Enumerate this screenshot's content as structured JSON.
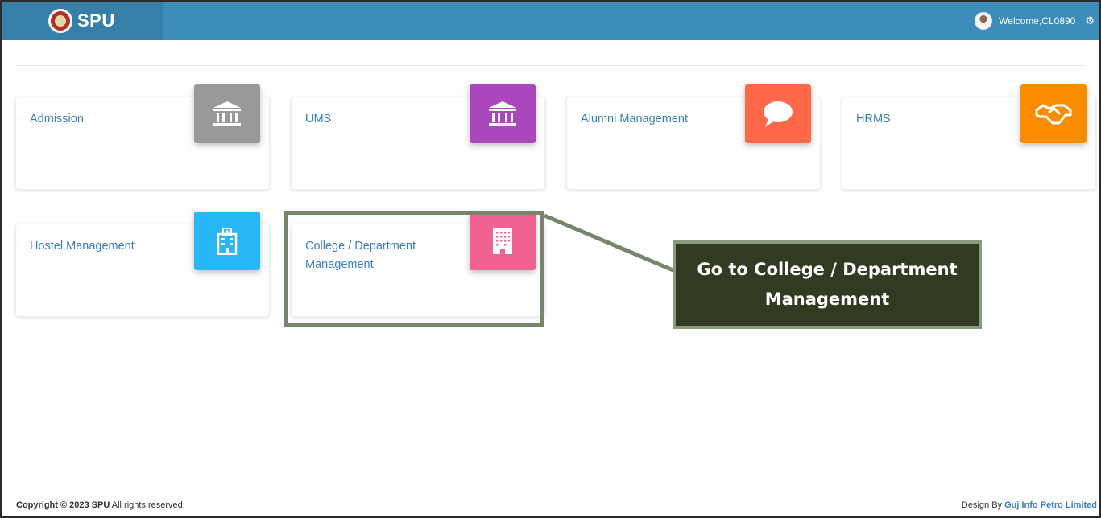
{
  "header": {
    "brand": "SPU",
    "welcome": "Welcome,CL0890"
  },
  "modules": [
    {
      "label": "Admission",
      "icon": "bank-icon",
      "color": "#999999"
    },
    {
      "label": "UMS",
      "icon": "bank-icon",
      "color": "#ab47bc"
    },
    {
      "label": "Alumni Management",
      "icon": "chat-bubble-icon",
      "color": "#ff6849"
    },
    {
      "label": "HRMS",
      "icon": "handshake-icon",
      "color": "#fb8c00"
    },
    {
      "label": "Hostel Management",
      "icon": "hospital-building-icon",
      "color": "#29b6f6"
    },
    {
      "label": "College / Department Management",
      "icon": "office-building-icon",
      "color": "#f06292"
    }
  ],
  "annotation": {
    "callout_text": "Go to College / Department Management",
    "highlight_color": "#77866b",
    "callout_bg": "#323a22"
  },
  "footer": {
    "copyright_prefix": "Copyright © 2023 SPU",
    "copyright_suffix": " All rights reserved.",
    "design_by": "Design By ",
    "company": "Guj Info Petro Limited"
  }
}
